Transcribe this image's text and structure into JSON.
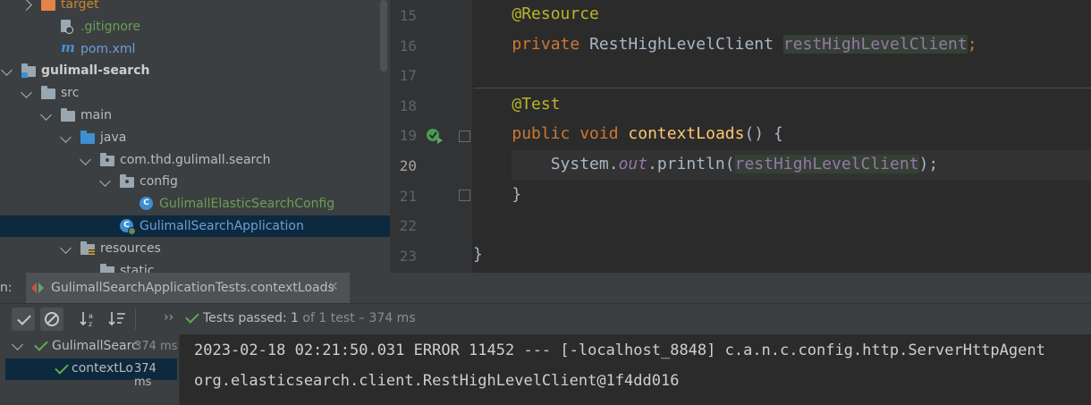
{
  "project_tree": {
    "items": [
      {
        "label": "target",
        "depth": 1,
        "arrow": "right",
        "icon": "orange-folder-icon",
        "style": "orange"
      },
      {
        "label": ".gitignore",
        "depth": 2,
        "icon": "gitignore-file-icon",
        "style": "green"
      },
      {
        "label": "pom.xml",
        "depth": 2,
        "icon": "maven-icon",
        "style": "blue"
      },
      {
        "label": "gulimall-search",
        "depth": 0,
        "arrow": "down",
        "icon": "module-folder-icon",
        "style": "bold"
      },
      {
        "label": "src",
        "depth": 1,
        "arrow": "down",
        "icon": "folder-icon",
        "style": "normal"
      },
      {
        "label": "main",
        "depth": 2,
        "arrow": "down",
        "icon": "folder-icon",
        "style": "normal"
      },
      {
        "label": "java",
        "depth": 3,
        "arrow": "down",
        "icon": "source-folder-icon",
        "style": "normal"
      },
      {
        "label": "com.thd.gulimall.search",
        "depth": 4,
        "arrow": "down",
        "icon": "package-icon",
        "style": "normal"
      },
      {
        "label": "config",
        "depth": 5,
        "arrow": "down",
        "icon": "package-icon",
        "style": "normal"
      },
      {
        "label": "GulimallElasticSearchConfig",
        "depth": 6,
        "icon": "class-icon",
        "style": "green"
      },
      {
        "label": "GulimallSearchApplication",
        "depth": 5,
        "icon": "spring-app-class-icon",
        "style": "blue",
        "selected": true
      },
      {
        "label": "resources",
        "depth": 3,
        "arrow": "down",
        "icon": "resources-folder-icon",
        "style": "normal"
      },
      {
        "label": "static",
        "depth": 4,
        "icon": "folder-icon",
        "style": "normal"
      }
    ]
  },
  "editor": {
    "line_numbers": [
      "15",
      "16",
      "17",
      "18",
      "19",
      "20",
      "21",
      "22",
      "23"
    ],
    "current_line": "20",
    "lines": [
      [
        {
          "t": "    ",
          "c": ""
        },
        {
          "t": "@Resource",
          "c": "ann"
        }
      ],
      [
        {
          "t": "    ",
          "c": ""
        },
        {
          "t": "private ",
          "c": "kw"
        },
        {
          "t": "RestHighLevelClient ",
          "c": ""
        },
        {
          "t": "restHighLevelClient",
          "c": "fld hl"
        },
        {
          "t": ";",
          "c": "kw"
        }
      ],
      [],
      [
        {
          "t": "    ",
          "c": ""
        },
        {
          "t": "@Test",
          "c": "ann"
        }
      ],
      [
        {
          "t": "    ",
          "c": ""
        },
        {
          "t": "public ",
          "c": "kw"
        },
        {
          "t": "void ",
          "c": "kw"
        },
        {
          "t": "contextLoads",
          "c": "fn"
        },
        {
          "t": "() {",
          "c": ""
        }
      ],
      [
        {
          "t": "        System.",
          "c": ""
        },
        {
          "t": "out",
          "c": "fldi"
        },
        {
          "t": ".println(",
          "c": ""
        },
        {
          "t": "restHighLevelClient",
          "c": "fld hl"
        },
        {
          "t": ");",
          "c": ""
        }
      ],
      [
        {
          "t": "    }",
          "c": ""
        }
      ],
      [],
      [
        {
          "t": "}",
          "c": ""
        }
      ]
    ]
  },
  "run_panel": {
    "prefix": "n:",
    "tab_label": "GulimallSearchApplicationTests.contextLoads",
    "status_prefix": "Tests passed: ",
    "status_count": "1",
    "status_rest": " of 1 test – 374 ms",
    "tree": [
      {
        "label": "GulimallSearc",
        "time": "374 ms"
      },
      {
        "label": "contextLo",
        "time": "374 ms"
      }
    ],
    "console": [
      "2023-02-18 02:21:50.031 ERROR 11452 --- [-localhost_8848] c.a.n.c.config.http.ServerHttpAgent",
      "org.elasticsearch.client.RestHighLevelClient@1f4dd016"
    ]
  }
}
